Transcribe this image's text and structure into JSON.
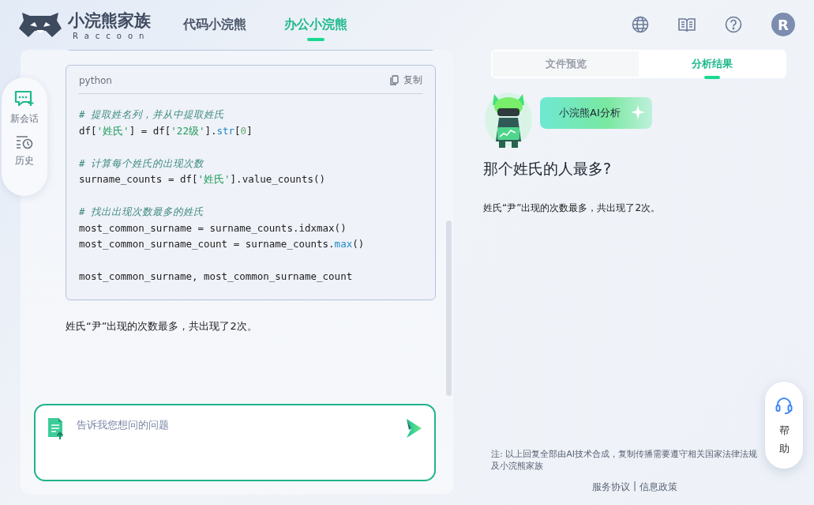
{
  "brand": {
    "name": "小浣熊家族",
    "sub": "Raccoon"
  },
  "nav": [
    {
      "label": "代码小浣熊",
      "selected": false
    },
    {
      "label": "办公小浣熊",
      "selected": true
    }
  ],
  "avatar": "R",
  "sidebar": [
    {
      "label": "新会话",
      "kind": "chat"
    },
    {
      "label": "历史",
      "kind": "history"
    }
  ],
  "code_block": {
    "language": "python",
    "copy_label": "复制",
    "lines": [
      {
        "kind": "comment",
        "text": "# 提取姓名列，并从中提取姓氏"
      },
      {
        "kind": "code",
        "segments": [
          {
            "kind": "plain",
            "t": "df["
          },
          {
            "kind": "string",
            "t": "'姓氏'"
          },
          {
            "kind": "plain",
            "t": "] = df["
          },
          {
            "kind": "string",
            "t": "'22级'"
          },
          {
            "kind": "plain",
            "t": "]."
          },
          {
            "kind": "func",
            "t": "str"
          },
          {
            "kind": "plain",
            "t": "["
          },
          {
            "kind": "number",
            "t": "0"
          },
          {
            "kind": "plain",
            "t": "]"
          }
        ]
      },
      {
        "kind": "blank"
      },
      {
        "kind": "comment",
        "text": "# 计算每个姓氏的出现次数"
      },
      {
        "kind": "code",
        "segments": [
          {
            "kind": "plain",
            "t": "surname_counts = df["
          },
          {
            "kind": "string",
            "t": "'姓氏'"
          },
          {
            "kind": "plain",
            "t": "].value_counts()"
          }
        ]
      },
      {
        "kind": "blank"
      },
      {
        "kind": "comment",
        "text": "# 找出出现次数最多的姓氏"
      },
      {
        "kind": "code",
        "segments": [
          {
            "kind": "plain",
            "t": "most_common_surname = surname_counts.idxmax()"
          }
        ]
      },
      {
        "kind": "code",
        "segments": [
          {
            "kind": "plain",
            "t": "most_common_surname_count = surname_counts."
          },
          {
            "kind": "func",
            "t": "max"
          },
          {
            "kind": "plain",
            "t": "()"
          }
        ]
      },
      {
        "kind": "blank"
      },
      {
        "kind": "code",
        "segments": [
          {
            "kind": "plain",
            "t": "most_common_surname, most_common_surname_count"
          }
        ]
      }
    ]
  },
  "chat_answer": "姓氏“尹”出现的次数最多，共出现了2次。",
  "input": {
    "placeholder": "告诉我您想问的问题"
  },
  "tabs": [
    {
      "label": "文件预览",
      "selected": false
    },
    {
      "label": "分析结果",
      "selected": true
    }
  ],
  "ai_badge": "小浣熊AI分析",
  "question": "那个姓氏的人最多?",
  "answer": "姓氏“尹”出现的次数最多，共出现了2次。",
  "note": "注: 以上回复全部由AI技术合成，复制传播需要遵守相关国家法律法规及小浣熊家族",
  "footer_links": [
    "服务协议",
    "信息政策"
  ],
  "footer_separator": "|",
  "help": "帮助"
}
